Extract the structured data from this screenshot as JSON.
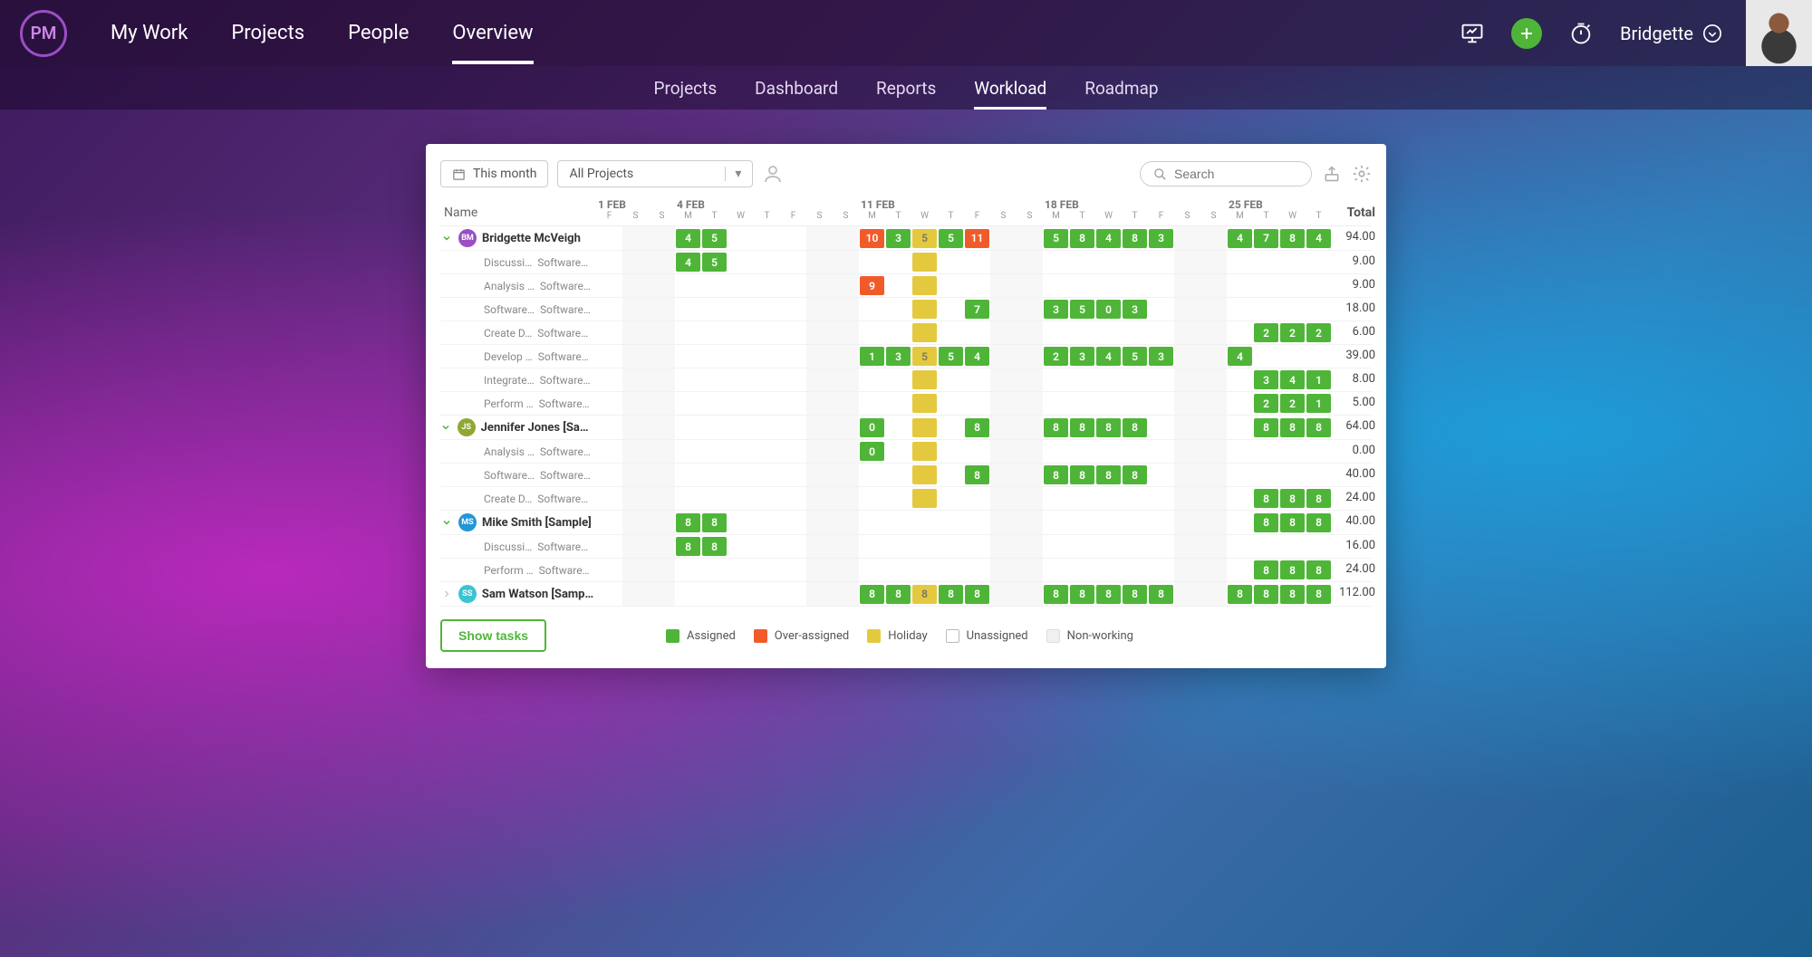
{
  "logo": "PM",
  "nav": [
    "My Work",
    "Projects",
    "People",
    "Overview"
  ],
  "nav_active": 3,
  "user_name": "Bridgette",
  "subnav": [
    "Projects",
    "Dashboard",
    "Reports",
    "Workload",
    "Roadmap"
  ],
  "subnav_active": 3,
  "toolbar": {
    "period": "This month",
    "project_filter": "All Projects",
    "search_placeholder": "Search"
  },
  "columns": {
    "name": "Name",
    "total": "Total"
  },
  "weeks": [
    {
      "label": "1 FEB",
      "days": [
        "F",
        "S",
        "S"
      ]
    },
    {
      "label": "4 FEB",
      "days": [
        "M",
        "T",
        "W",
        "T",
        "F",
        "S",
        "S"
      ]
    },
    {
      "label": "11 FEB",
      "days": [
        "M",
        "T",
        "W",
        "T",
        "F",
        "S",
        "S"
      ]
    },
    {
      "label": "18 FEB",
      "days": [
        "M",
        "T",
        "W",
        "T",
        "F",
        "S",
        "S"
      ]
    },
    {
      "label": "25 FEB",
      "days": [
        "M",
        "T",
        "W",
        "T"
      ]
    }
  ],
  "weekend_cols": [
    1,
    2,
    8,
    9,
    15,
    16,
    22,
    23
  ],
  "holiday_col": 12,
  "rows": [
    {
      "type": "person",
      "expanded": true,
      "badge": "BM",
      "badge_cls": "bm",
      "name": "Bridgette McVeigh",
      "total": "94.00",
      "cells": {
        "3": {
          "v": "4",
          "k": "assigned"
        },
        "4": {
          "v": "5",
          "k": "assigned"
        },
        "10": {
          "v": "10",
          "k": "over"
        },
        "11": {
          "v": "3",
          "k": "assigned"
        },
        "12": {
          "v": "5",
          "k": "holiday"
        },
        "13": {
          "v": "5",
          "k": "assigned"
        },
        "14": {
          "v": "11",
          "k": "over"
        },
        "17": {
          "v": "5",
          "k": "assigned"
        },
        "18": {
          "v": "8",
          "k": "assigned"
        },
        "19": {
          "v": "4",
          "k": "assigned"
        },
        "20": {
          "v": "8",
          "k": "assigned"
        },
        "21": {
          "v": "3",
          "k": "assigned"
        },
        "24": {
          "v": "4",
          "k": "assigned"
        },
        "25": {
          "v": "7",
          "k": "assigned"
        },
        "26": {
          "v": "8",
          "k": "assigned"
        },
        "27": {
          "v": "4",
          "k": "assigned"
        }
      }
    },
    {
      "type": "task",
      "name": "Discussi…",
      "proj": "Software…",
      "total": "9.00",
      "cells": {
        "3": {
          "v": "4",
          "k": "assigned"
        },
        "4": {
          "v": "5",
          "k": "assigned"
        },
        "12": {
          "v": "",
          "k": "holiday"
        }
      }
    },
    {
      "type": "task",
      "name": "Analysis …",
      "proj": "Software…",
      "total": "9.00",
      "cells": {
        "10": {
          "v": "9",
          "k": "over"
        },
        "12": {
          "v": "",
          "k": "holiday"
        }
      }
    },
    {
      "type": "task",
      "name": "Software…",
      "proj": "Software…",
      "total": "18.00",
      "cells": {
        "12": {
          "v": "",
          "k": "holiday"
        },
        "14": {
          "v": "7",
          "k": "assigned"
        },
        "17": {
          "v": "3",
          "k": "assigned"
        },
        "18": {
          "v": "5",
          "k": "assigned"
        },
        "19": {
          "v": "0",
          "k": "assigned"
        },
        "20": {
          "v": "3",
          "k": "assigned"
        }
      }
    },
    {
      "type": "task",
      "name": "Create D…",
      "proj": "Software…",
      "total": "6.00",
      "cells": {
        "12": {
          "v": "",
          "k": "holiday"
        },
        "25": {
          "v": "2",
          "k": "assigned"
        },
        "26": {
          "v": "2",
          "k": "assigned"
        },
        "27": {
          "v": "2",
          "k": "assigned"
        }
      }
    },
    {
      "type": "task",
      "name": "Develop …",
      "proj": "Software…",
      "total": "39.00",
      "cells": {
        "10": {
          "v": "1",
          "k": "assigned"
        },
        "11": {
          "v": "3",
          "k": "assigned"
        },
        "12": {
          "v": "5",
          "k": "holiday"
        },
        "13": {
          "v": "5",
          "k": "assigned"
        },
        "14": {
          "v": "4",
          "k": "assigned"
        },
        "17": {
          "v": "2",
          "k": "assigned"
        },
        "18": {
          "v": "3",
          "k": "assigned"
        },
        "19": {
          "v": "4",
          "k": "assigned"
        },
        "20": {
          "v": "5",
          "k": "assigned"
        },
        "21": {
          "v": "3",
          "k": "assigned"
        },
        "24": {
          "v": "4",
          "k": "assigned"
        }
      }
    },
    {
      "type": "task",
      "name": "Integrate…",
      "proj": "Software…",
      "total": "8.00",
      "cells": {
        "12": {
          "v": "",
          "k": "holiday"
        },
        "25": {
          "v": "3",
          "k": "assigned"
        },
        "26": {
          "v": "4",
          "k": "assigned"
        },
        "27": {
          "v": "1",
          "k": "assigned"
        }
      }
    },
    {
      "type": "task",
      "name": "Perform …",
      "proj": "Software…",
      "total": "5.00",
      "cells": {
        "12": {
          "v": "",
          "k": "holiday"
        },
        "25": {
          "v": "2",
          "k": "assigned"
        },
        "26": {
          "v": "2",
          "k": "assigned"
        },
        "27": {
          "v": "1",
          "k": "assigned"
        }
      }
    },
    {
      "type": "person",
      "expanded": true,
      "badge": "JS",
      "badge_cls": "js",
      "name": "Jennifer Jones [Sampl…",
      "total": "64.00",
      "cells": {
        "10": {
          "v": "0",
          "k": "assigned"
        },
        "12": {
          "v": "",
          "k": "holiday"
        },
        "14": {
          "v": "8",
          "k": "assigned"
        },
        "17": {
          "v": "8",
          "k": "assigned"
        },
        "18": {
          "v": "8",
          "k": "assigned"
        },
        "19": {
          "v": "8",
          "k": "assigned"
        },
        "20": {
          "v": "8",
          "k": "assigned"
        },
        "25": {
          "v": "8",
          "k": "assigned"
        },
        "26": {
          "v": "8",
          "k": "assigned"
        },
        "27": {
          "v": "8",
          "k": "assigned"
        }
      }
    },
    {
      "type": "task",
      "name": "Analysis …",
      "proj": "Software…",
      "total": "0.00",
      "cells": {
        "10": {
          "v": "0",
          "k": "assigned"
        },
        "12": {
          "v": "",
          "k": "holiday"
        }
      }
    },
    {
      "type": "task",
      "name": "Software…",
      "proj": "Software…",
      "total": "40.00",
      "cells": {
        "12": {
          "v": "",
          "k": "holiday"
        },
        "14": {
          "v": "8",
          "k": "assigned"
        },
        "17": {
          "v": "8",
          "k": "assigned"
        },
        "18": {
          "v": "8",
          "k": "assigned"
        },
        "19": {
          "v": "8",
          "k": "assigned"
        },
        "20": {
          "v": "8",
          "k": "assigned"
        }
      }
    },
    {
      "type": "task",
      "name": "Create D…",
      "proj": "Software…",
      "total": "24.00",
      "cells": {
        "12": {
          "v": "",
          "k": "holiday"
        },
        "25": {
          "v": "8",
          "k": "assigned"
        },
        "26": {
          "v": "8",
          "k": "assigned"
        },
        "27": {
          "v": "8",
          "k": "assigned"
        }
      }
    },
    {
      "type": "person",
      "expanded": true,
      "badge": "MS",
      "badge_cls": "ms",
      "name": "Mike Smith [Sample]",
      "total": "40.00",
      "cells": {
        "3": {
          "v": "8",
          "k": "assigned"
        },
        "4": {
          "v": "8",
          "k": "assigned"
        },
        "25": {
          "v": "8",
          "k": "assigned"
        },
        "26": {
          "v": "8",
          "k": "assigned"
        },
        "27": {
          "v": "8",
          "k": "assigned"
        }
      }
    },
    {
      "type": "task",
      "name": "Discussi…",
      "proj": "Software…",
      "total": "16.00",
      "cells": {
        "3": {
          "v": "8",
          "k": "assigned"
        },
        "4": {
          "v": "8",
          "k": "assigned"
        }
      }
    },
    {
      "type": "task",
      "name": "Perform …",
      "proj": "Software…",
      "total": "24.00",
      "cells": {
        "25": {
          "v": "8",
          "k": "assigned"
        },
        "26": {
          "v": "8",
          "k": "assigned"
        },
        "27": {
          "v": "8",
          "k": "assigned"
        }
      }
    },
    {
      "type": "person",
      "expanded": false,
      "badge": "SS",
      "badge_cls": "ss",
      "name": "Sam Watson [Sample]",
      "total": "112.00",
      "cells": {
        "10": {
          "v": "8",
          "k": "assigned"
        },
        "11": {
          "v": "8",
          "k": "assigned"
        },
        "12": {
          "v": "8",
          "k": "holiday"
        },
        "13": {
          "v": "8",
          "k": "assigned"
        },
        "14": {
          "v": "8",
          "k": "assigned"
        },
        "17": {
          "v": "8",
          "k": "assigned"
        },
        "18": {
          "v": "8",
          "k": "assigned"
        },
        "19": {
          "v": "8",
          "k": "assigned"
        },
        "20": {
          "v": "8",
          "k": "assigned"
        },
        "21": {
          "v": "8",
          "k": "assigned"
        },
        "24": {
          "v": "8",
          "k": "assigned"
        },
        "25": {
          "v": "8",
          "k": "assigned"
        },
        "26": {
          "v": "8",
          "k": "assigned"
        },
        "27": {
          "v": "8",
          "k": "assigned"
        }
      }
    }
  ],
  "legend": {
    "button": "Show tasks",
    "items": [
      "Assigned",
      "Over-assigned",
      "Holiday",
      "Unassigned",
      "Non-working"
    ]
  }
}
